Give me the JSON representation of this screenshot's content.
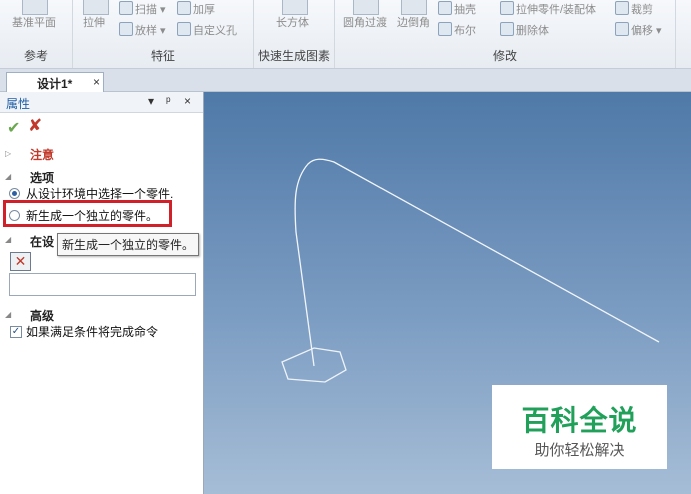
{
  "ribbon": {
    "group_ref": {
      "label": "参考",
      "btn_baseplane": "基准平面"
    },
    "group_feature": {
      "label": "特征",
      "btn_extrude": "拉伸",
      "btn_sweep": "扫描",
      "btn_thicken": "加厚",
      "btn_loft": "放样",
      "btn_custom_hole": "自定义孔"
    },
    "group_quick": {
      "label": "快速生成图素",
      "btn_box": "长方体"
    },
    "group_modify": {
      "label": "修改",
      "btn_fillet": "圆角过渡",
      "btn_chamfer": "边倒角",
      "btn_shell": "抽壳",
      "btn_boolean": "布尔",
      "btn_extrude_part": "拉伸零件/装配体",
      "btn_delete_body": "删除体",
      "btn_trim": "裁剪",
      "btn_offset": "偏移"
    }
  },
  "tab": {
    "label": "设计1*",
    "close": "×"
  },
  "panel": {
    "title": "属性",
    "pin_glyph": "▾",
    "pin2_glyph": "ᵖ",
    "close_glyph": "×",
    "ok_glyph": "✔",
    "cancel_glyph": "✘",
    "notice_label": "注意",
    "options_label": "选项",
    "option1": "从设计环境中选择一个零件.",
    "option2": "新生成一个独立的零件。",
    "tooltip": "新生成一个独立的零件。",
    "in_design_label": "在设",
    "advanced_label": "高级",
    "checkbox_label": "如果满足条件将完成命令",
    "checkbox_checked": true,
    "remove_glyph": "✕"
  },
  "watermark": {
    "title": "百科全说",
    "subtitle": "助你轻松解决"
  },
  "colors": {
    "accent": "#1f5fa6",
    "highlight_box": "#d0212a",
    "watermark_green": "#21a05a"
  }
}
